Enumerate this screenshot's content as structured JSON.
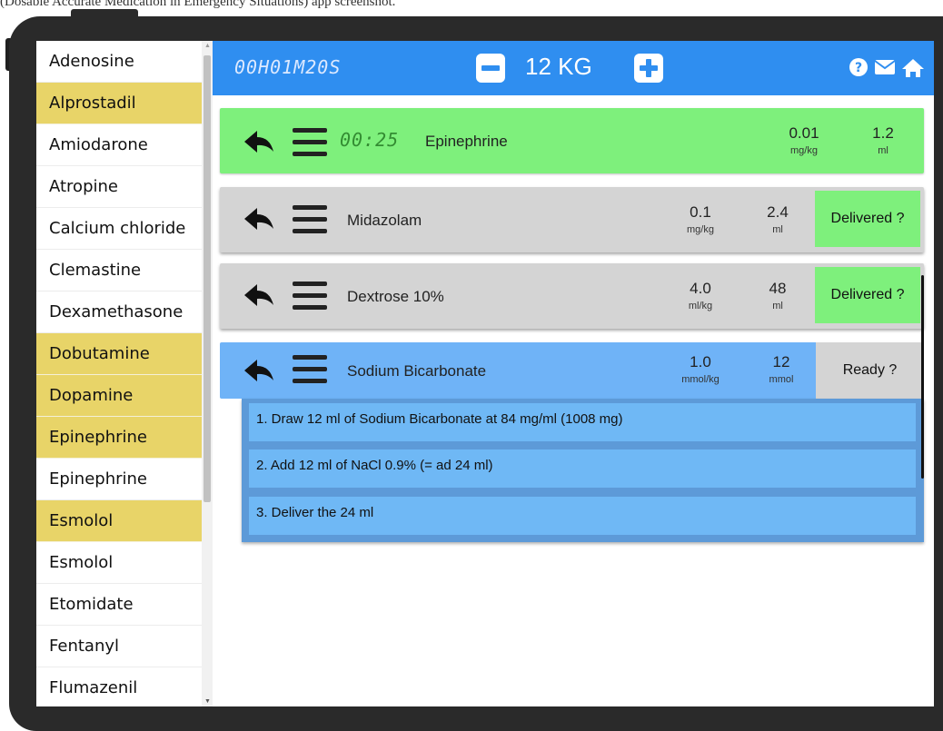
{
  "caption": "(Dosable Accurate Medication in Emergency Situations) app screenshot.",
  "sidebar": {
    "items": [
      {
        "label": "Adenosine",
        "highlighted": false
      },
      {
        "label": "Alprostadil",
        "highlighted": true
      },
      {
        "label": "Amiodarone",
        "highlighted": false
      },
      {
        "label": "Atropine",
        "highlighted": false
      },
      {
        "label": "Calcium chloride",
        "highlighted": false
      },
      {
        "label": "Clemastine",
        "highlighted": false
      },
      {
        "label": "Dexamethasone",
        "highlighted": false
      },
      {
        "label": "Dobutamine",
        "highlighted": true
      },
      {
        "label": "Dopamine",
        "highlighted": true
      },
      {
        "label": "Epinephrine",
        "highlighted": true
      },
      {
        "label": "Epinephrine",
        "highlighted": false
      },
      {
        "label": "Esmolol",
        "highlighted": true
      },
      {
        "label": "Esmolol",
        "highlighted": false
      },
      {
        "label": "Etomidate",
        "highlighted": false
      },
      {
        "label": "Fentanyl",
        "highlighted": false
      },
      {
        "label": "Flumazenil",
        "highlighted": false
      }
    ]
  },
  "header": {
    "timer": "00H01M20S",
    "weight": "12 KG",
    "icons": [
      "minus-icon",
      "plus-icon",
      "help-icon",
      "mail-icon",
      "home-icon"
    ]
  },
  "rows": [
    {
      "timer": "00:25",
      "name": "Epinephrine",
      "dose": "0.01",
      "dose_unit": "mg/kg",
      "volume": "1.2",
      "volume_unit": "ml"
    },
    {
      "name": "Midazolam",
      "dose": "0.1",
      "dose_unit": "mg/kg",
      "volume": "2.4",
      "volume_unit": "ml",
      "action": "Delivered ?"
    },
    {
      "name": "Dextrose 10%",
      "dose": "4.0",
      "dose_unit": "ml/kg",
      "volume": "48",
      "volume_unit": "ml",
      "action": "Delivered ?"
    },
    {
      "name": "Sodium Bicarbonate",
      "dose": "1.0",
      "dose_unit": "mmol/kg",
      "volume": "12",
      "volume_unit": "mmol",
      "action": "Ready ?"
    }
  ],
  "steps": [
    "1.  Draw 12 ml of Sodium Bicarbonate at 84 mg/ml (1008 mg)",
    "2.  Add 12 ml of NaCl 0.9% (= ad 24 ml)",
    "3.  Deliver the 24 ml"
  ],
  "colors": {
    "header_blue": "#2f8ef0",
    "active_green": "#7ef07c",
    "inactive_gray": "#d4d4d4",
    "selected_blue": "#6fb3f7",
    "sidebar_highlight": "#e8d468"
  }
}
